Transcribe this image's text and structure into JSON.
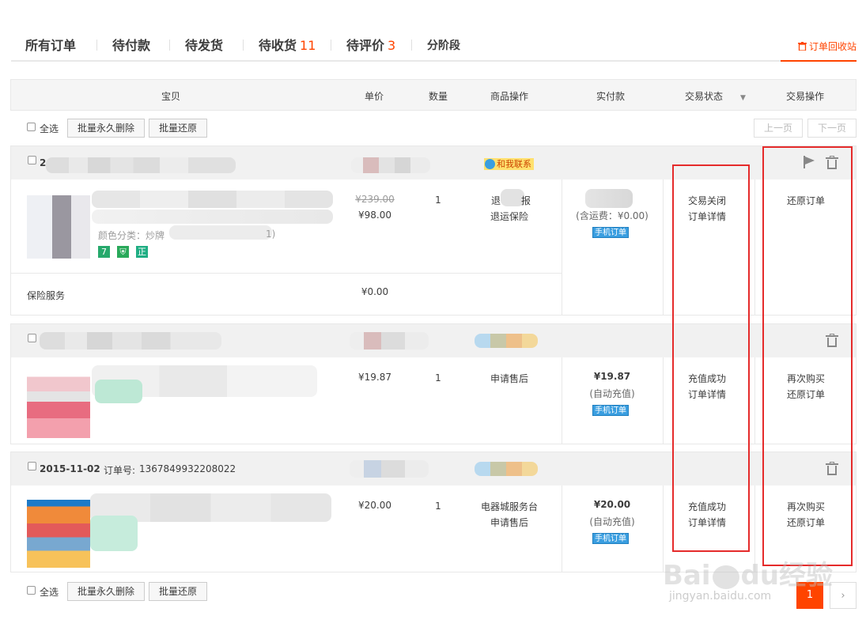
{
  "tabs": [
    {
      "label": "所有订单",
      "count": ""
    },
    {
      "label": "待付款",
      "count": ""
    },
    {
      "label": "待发货",
      "count": ""
    },
    {
      "label": "待收货",
      "count": "11"
    },
    {
      "label": "待评价",
      "count": "3"
    },
    {
      "label": "分阶段",
      "count": ""
    }
  ],
  "recycle_label": "订单回收站",
  "columns": [
    "宝贝",
    "单价",
    "数量",
    "商品操作",
    "实付款",
    "交易状态",
    "交易操作"
  ],
  "batch": {
    "select_all": "全选",
    "delete_forever": "批量永久删除",
    "restore": "批量还原",
    "prev_page": "上一页",
    "next_page": "下一页"
  },
  "orders": [
    {
      "date": "2",
      "order_label": "",
      "order_no": "",
      "contact": "和我联系",
      "item": {
        "title": "",
        "spec": "颜色分类：炒牌",
        "spec_tail": "1)",
        "original_price": "¥239.00",
        "price": "¥98.00",
        "quantity": "1",
        "item_ops": [
          "退",
          "报",
          "退运保险"
        ],
        "paid": "",
        "paid_note": "(含运费：¥0.00)",
        "mobile_tag": "手机订单",
        "status": [
          "交易关闭",
          "订单详情"
        ],
        "actions": [
          "还原订单"
        ]
      },
      "insurance": {
        "label": "保险服务",
        "price": "¥0.00"
      }
    },
    {
      "date": "",
      "order_label": "",
      "order_no": "",
      "item": {
        "price": "¥19.87",
        "quantity": "1",
        "item_ops": [
          "申请售后"
        ],
        "paid": "¥19.87",
        "paid_note": "(自动充值)",
        "mobile_tag": "手机订单",
        "status": [
          "充值成功",
          "订单详情"
        ],
        "actions": [
          "再次购买",
          "还原订单"
        ]
      }
    },
    {
      "date": "2015-11-02",
      "order_label": "订单号:",
      "order_no": "1367849932208022",
      "item": {
        "price": "¥20.00",
        "quantity": "1",
        "item_ops": [
          "电器城服务台",
          "申请售后"
        ],
        "paid": "¥20.00",
        "paid_note": "(自动充值)",
        "mobile_tag": "手机订单",
        "status": [
          "充值成功",
          "订单详情"
        ],
        "actions": [
          "再次购买",
          "还原订单"
        ]
      }
    }
  ],
  "pagination": {
    "current": "1",
    "next": "›"
  },
  "watermark": {
    "brand": "Bai",
    "brand2": "du",
    "cn": "经验",
    "url": "jingyan.baidu.com"
  },
  "colors": {
    "accent": "#ff4400",
    "red_box": "#e52b2b",
    "mobile_tag": "#3a9ee0"
  }
}
